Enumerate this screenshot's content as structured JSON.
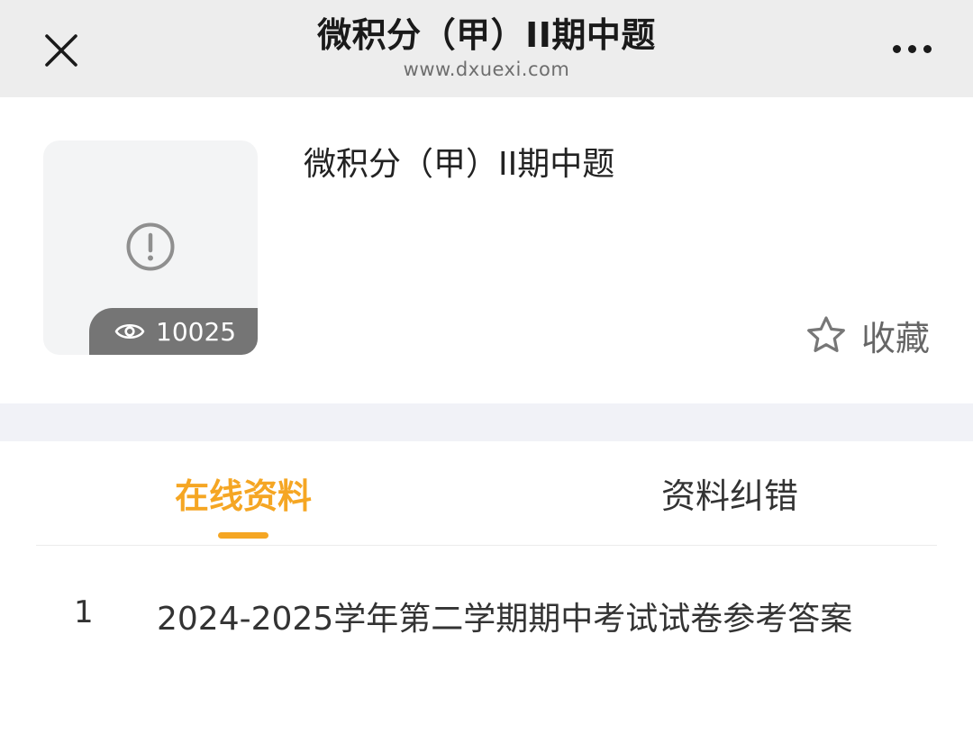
{
  "header": {
    "title": "微积分（甲）II期中题",
    "subtitle": "www.dxuexi.com",
    "close_icon": "close-icon",
    "more_icon": "more-icon"
  },
  "resource": {
    "title": "微积分（甲）II期中题",
    "view_count": "10025",
    "thumbnail_icon": "warning-icon",
    "favorite_label": "收藏"
  },
  "tabs": [
    {
      "label": "在线资料",
      "active": true
    },
    {
      "label": "资料纠错",
      "active": false
    }
  ],
  "items": [
    {
      "index": "1",
      "title": "2024-2025学年第二学期期中考试试卷参考答案"
    }
  ],
  "colors": {
    "accent": "#f5a623",
    "header_bg": "#ededed",
    "band_bg": "#f1f2f7",
    "badge_bg": "#757575"
  }
}
